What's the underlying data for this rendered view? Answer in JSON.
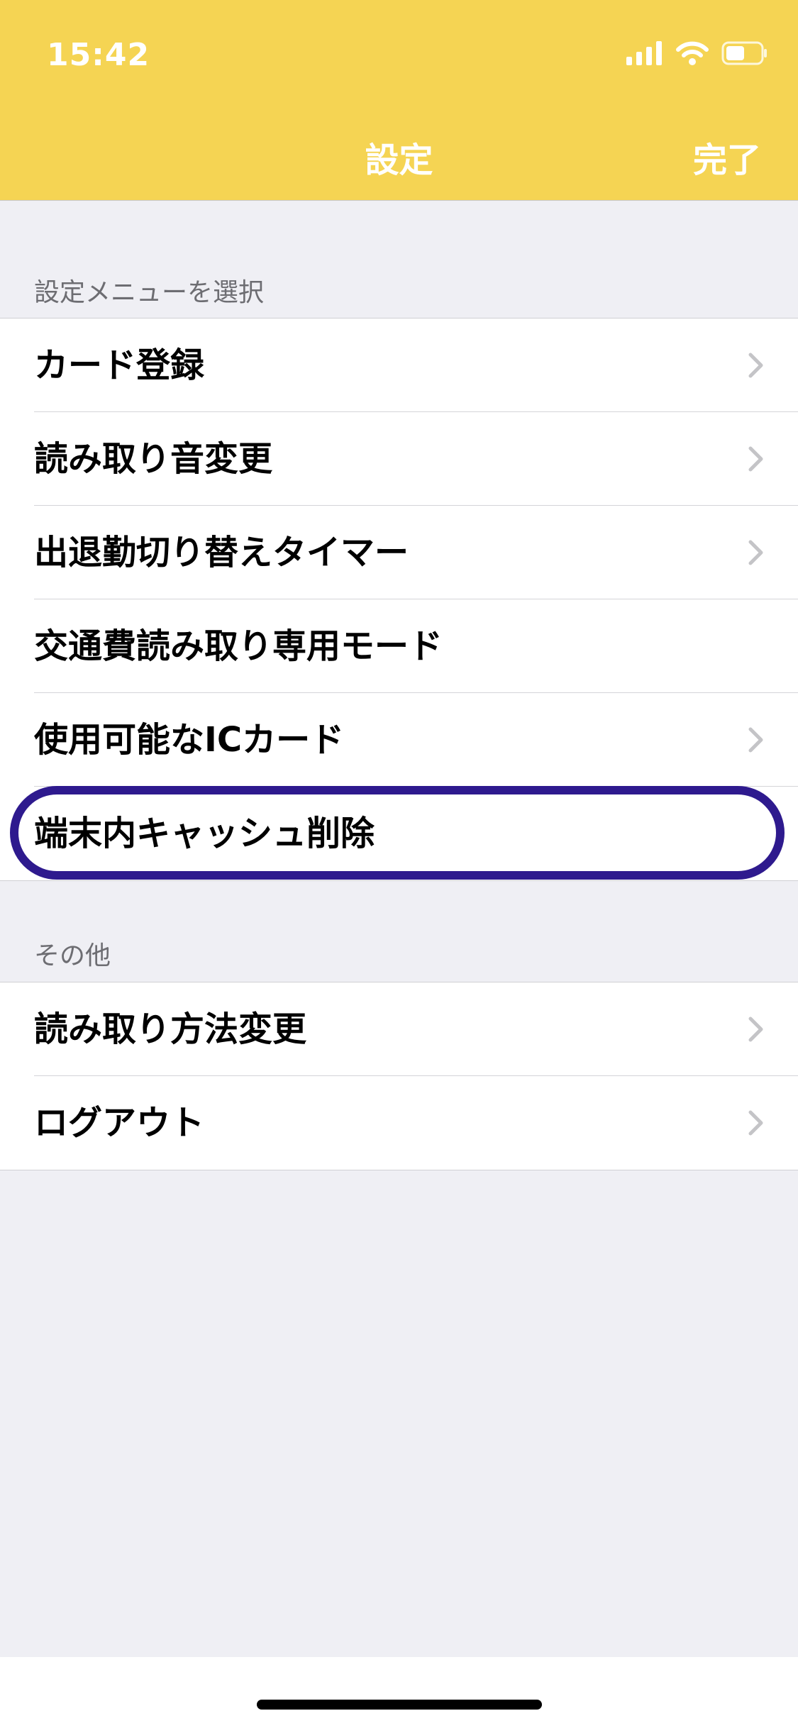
{
  "status_bar": {
    "time": "15:42",
    "icons": [
      "signal-icon",
      "wifi-icon",
      "battery-icon"
    ],
    "battery_level": 0.55
  },
  "nav": {
    "title": "設定",
    "done_label": "完了"
  },
  "sections": [
    {
      "header": "設定メニューを選択",
      "items": [
        {
          "label": "カード登録",
          "chevron": true
        },
        {
          "label": "読み取り音変更",
          "chevron": true
        },
        {
          "label": "出退勤切り替えタイマー",
          "chevron": true
        },
        {
          "label": "交通費読み取り専用モード",
          "chevron": false
        },
        {
          "label": "使用可能なICカード",
          "chevron": true
        },
        {
          "label": "端末内キャッシュ削除",
          "chevron": false,
          "highlighted": true
        }
      ]
    },
    {
      "header": "その他",
      "items": [
        {
          "label": "読み取り方法変更",
          "chevron": true
        },
        {
          "label": "ログアウト",
          "chevron": true
        }
      ]
    }
  ],
  "colors": {
    "header_bg": "#f5d453",
    "highlight_ring": "#2e1a8e",
    "list_bg": "#efeff4",
    "chevron": "#c4c4c7"
  }
}
